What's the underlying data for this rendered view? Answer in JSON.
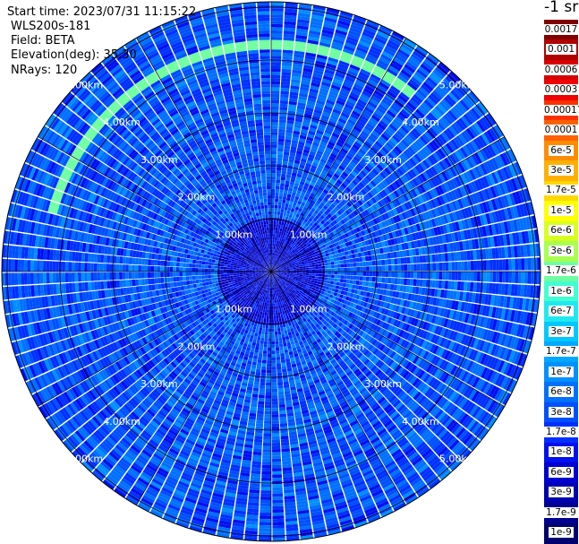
{
  "info": {
    "start_time": "Start time: 2023/07/31 11:15:22",
    "instrument": "WLS200s-181",
    "field": "Field: BETA",
    "elevation": "Elevation(deg): 35.30",
    "nrays": "NRays: 120"
  },
  "colorbar": {
    "unit": "-1 sr",
    "labels": [
      "0.0017",
      "0.001",
      "0.0006",
      "0.0003",
      "0.00017",
      "0.0001",
      "6e-5",
      "3e-5",
      "1.7e-5",
      "1e-5",
      "6e-6",
      "3e-6",
      "1.7e-6",
      "1e-6",
      "6e-7",
      "3e-7",
      "1.7e-7",
      "1e-7",
      "6e-8",
      "3e-8",
      "1.7e-8",
      "1e-8",
      "6e-9",
      "3e-9",
      "1.7e-9",
      "1e-9"
    ],
    "colors": [
      "#800000",
      "#b00000",
      "#d80000",
      "#f00000",
      "#ff3000",
      "#ff6000",
      "#ff8c00",
      "#ffb000",
      "#ffd800",
      "#ffff00",
      "#d8ff20",
      "#a8ff50",
      "#70ffa0",
      "#40ffd0",
      "#20e8f0",
      "#00c8ff",
      "#00a8ff",
      "#0090ff",
      "#0070ff",
      "#0050ff",
      "#0030ff",
      "#0010f0",
      "#0000d0",
      "#0000b0",
      "#000090",
      "#000070"
    ]
  },
  "chart_data": {
    "type": "heatmap",
    "projection": "polar PPI",
    "field": "BETA",
    "rays": 120,
    "range_rings_km": [
      1.0,
      2.0,
      3.0,
      4.0,
      5.0
    ],
    "range_ring_labels": [
      "1.00km",
      "2.00km",
      "3.00km",
      "4.00km",
      "5.00km"
    ],
    "max_range_km": 5.1,
    "azimuth_lines_deg": [
      0,
      30,
      60,
      90,
      120,
      150,
      180,
      210,
      240,
      270,
      300,
      330
    ],
    "color_scale": "log",
    "vmin": 1e-09,
    "vmax": 0.0017,
    "typical_value": 3e-08,
    "near_range_value": 6e-09,
    "features": [
      {
        "description": "high-backscatter arc",
        "range_km": 4.3,
        "azimuth_start_deg": 285,
        "azimuth_end_deg": 360,
        "value": 1.7e-06
      },
      {
        "description": "high-backscatter arc",
        "range_km": 4.3,
        "azimuth_start_deg": 0,
        "azimuth_end_deg": 40,
        "value": 1.7e-06
      }
    ]
  }
}
